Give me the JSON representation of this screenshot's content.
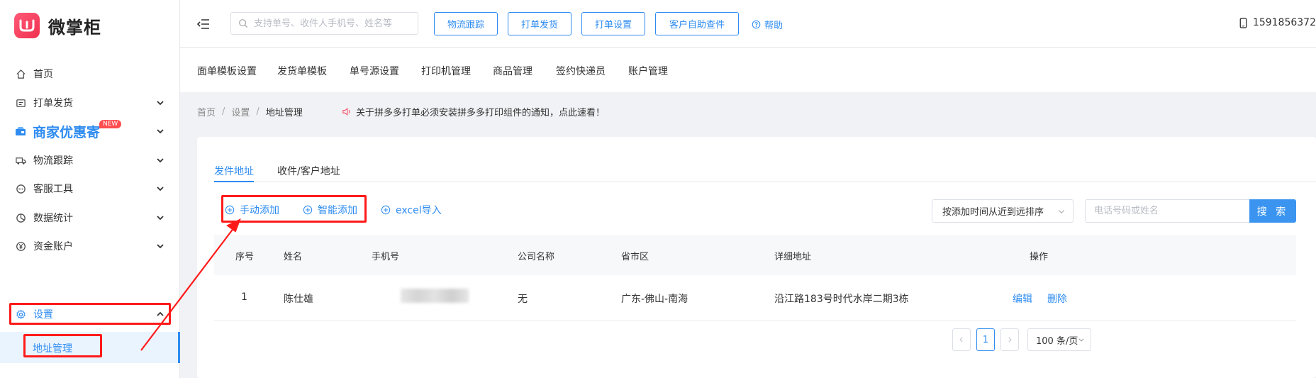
{
  "brand": {
    "name": "微掌柜",
    "accent": "#2e8cf0",
    "logo_color": "#f0304f"
  },
  "sidebar": {
    "items": [
      {
        "label": "首页",
        "icon": "home-icon"
      },
      {
        "label": "打单发货",
        "icon": "printer-icon"
      },
      {
        "label": "商家优惠寄",
        "icon": "package-icon",
        "badge": "NEW"
      },
      {
        "label": "物流跟踪",
        "icon": "truck-icon"
      },
      {
        "label": "客服工具",
        "icon": "chat-icon"
      },
      {
        "label": "数据统计",
        "icon": "pie-chart-icon"
      },
      {
        "label": "资金账户",
        "icon": "yen-icon"
      },
      {
        "label": "设置",
        "icon": "gear-icon"
      }
    ],
    "subitem": "地址管理"
  },
  "header": {
    "search_placeholder": "支持单号、收件人手机号、姓名等",
    "buttons": [
      "物流跟踪",
      "打单发货",
      "打单设置",
      "客户自助查件"
    ],
    "help": "帮助",
    "phone": "1591856372"
  },
  "subnav": [
    "面单模板设置",
    "发货单模板",
    "单号源设置",
    "打印机管理",
    "商品管理",
    "签约快递员",
    "账户管理"
  ],
  "breadcrumb": [
    "首页",
    "设置",
    "地址管理"
  ],
  "notice": "关于拼多多打单必须安装拼多多打印组件的通知，点此速看！",
  "tabs": [
    "发件地址",
    "收件/客户地址"
  ],
  "actions": [
    "手动添加",
    "智能添加",
    "excel导入"
  ],
  "sort": "按添加时间从近到远排序",
  "table_search": {
    "placeholder": "电话号码或姓名",
    "button": "搜 索"
  },
  "table": {
    "columns": [
      "序号",
      "姓名",
      "手机号",
      "公司名称",
      "省市区",
      "详细地址",
      "操作"
    ],
    "rows": [
      {
        "index": "1",
        "name": "陈仕雄",
        "phone": "",
        "company": "无",
        "region": "广东-佛山-南海",
        "address": "沿江路183号时代水岸二期3栋",
        "edit": "编辑",
        "delete": "删除"
      }
    ]
  },
  "pagination": {
    "current": "1",
    "page_size": "100 条/页"
  }
}
